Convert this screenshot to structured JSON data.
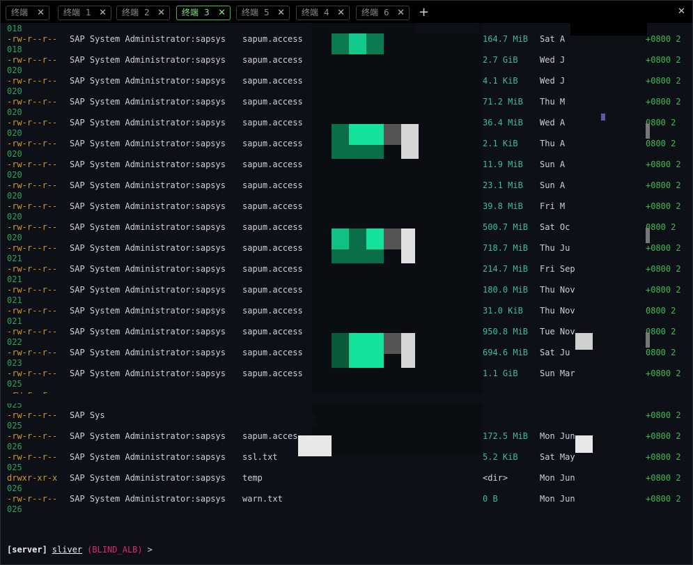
{
  "tabs": [
    {
      "label": "终端",
      "num": ""
    },
    {
      "label": "终端",
      "num": "1"
    },
    {
      "label": "终端",
      "num": "2"
    },
    {
      "label": "终端",
      "num": "3",
      "active": true
    },
    {
      "label": "终端",
      "num": "5"
    },
    {
      "label": "终端",
      "num": "4"
    },
    {
      "label": "终端",
      "num": "6"
    }
  ],
  "new_tab": "+",
  "close_glyph": "✕",
  "continuations": [
    "018",
    "018",
    "020",
    "020",
    "020",
    "020",
    "020",
    "020",
    "020",
    "020",
    "020",
    "021",
    "021",
    "021",
    "021",
    "022",
    "023",
    "025",
    "025",
    "025",
    "026",
    "025",
    "026",
    "026"
  ],
  "listing": [
    {
      "perm": "-rw-r--r--",
      "owner": "SAP System Administrator:sapsys",
      "name": "sapum.access",
      "size": "164.7 MiB",
      "date": "Sat A",
      "tz": "+0800 2"
    },
    {
      "perm": "-rw-r--r--",
      "owner": "SAP System Administrator:sapsys",
      "name": "sapum.access",
      "size": "2.7 GiB",
      "date": "Wed J",
      "tz": "+0800 2"
    },
    {
      "perm": "-rw-r--r--",
      "owner": "SAP System Administrator:sapsys",
      "name": "sapum.access",
      "size": "4.1 KiB",
      "date": "Wed J",
      "tz": "+0800 2"
    },
    {
      "perm": "-rw-r--r--",
      "owner": "SAP System Administrator:sapsys",
      "name": "sapum.access",
      "size": "71.2 MiB",
      "date": "Thu M",
      "tz": "+0800 2"
    },
    {
      "perm": "-rw-r--r--",
      "owner": "SAP System Administrator:sapsys",
      "name": "sapum.access",
      "size": "36.4 MiB",
      "date": "Wed A",
      "tz": "0800 2"
    },
    {
      "perm": "-rw-r--r--",
      "owner": "SAP System Administrator:sapsys",
      "name": "sapum.access",
      "size": "2.1 KiB",
      "date": "Thu A",
      "tz": "0800 2"
    },
    {
      "perm": "-rw-r--r--",
      "owner": "SAP System Administrator:sapsys",
      "name": "sapum.access",
      "size": "11.9 MiB",
      "date": "Sun A",
      "tz": "+0800 2"
    },
    {
      "perm": "-rw-r--r--",
      "owner": "SAP System Administrator:sapsys",
      "name": "sapum.access",
      "size": "23.1 MiB",
      "date": "Sun A",
      "tz": "+0800 2"
    },
    {
      "perm": "-rw-r--r--",
      "owner": "SAP System Administrator:sapsys",
      "name": "sapum.access",
      "size": "39.8 MiB",
      "date": "Fri M",
      "tz": "+0800 2"
    },
    {
      "perm": "-rw-r--r--",
      "owner": "SAP System Administrator:sapsys",
      "name": "sapum.access",
      "size": "500.7 MiB",
      "date": "Sat Oc",
      "tz": "0800 2"
    },
    {
      "perm": "-rw-r--r--",
      "owner": "SAP System Administrator:sapsys",
      "name": "sapum.access",
      "size": "718.7 MiB",
      "date": "Thu Ju",
      "tz": "+0800 2"
    },
    {
      "perm": "-rw-r--r--",
      "owner": "SAP System Administrator:sapsys",
      "name": "sapum.access",
      "size": "214.7 MiB",
      "date": "Fri Sep",
      "tz": "+0800 2"
    },
    {
      "perm": "-rw-r--r--",
      "owner": "SAP System Administrator:sapsys",
      "name": "sapum.access",
      "size": "180.0 MiB",
      "date": "Thu Nov",
      "tz": "+0800 2"
    },
    {
      "perm": "-rw-r--r--",
      "owner": "SAP System Administrator:sapsys",
      "name": "sapum.access",
      "size": "31.0 KiB",
      "date": "Thu Nov",
      "tz": "0800 2"
    },
    {
      "perm": "-rw-r--r--",
      "owner": "SAP System Administrator:sapsys",
      "name": "sapum.access",
      "size": "950.8 MiB",
      "date": "Tue Nov",
      "tz": "0800 2"
    },
    {
      "perm": "-rw-r--r--",
      "owner": "SAP System Administrator:sapsys",
      "name": "sapum.access",
      "size": "694.6 MiB",
      "date": "Sat Ju",
      "tz": "0800 2"
    },
    {
      "perm": "-rw-r--r--",
      "owner": "SAP System Administrator:sapsys",
      "name": "sapum.access",
      "size": "1.1 GiB",
      "date": "Sun Mar",
      "tz": "+0800 2"
    },
    {
      "perm": "-rw-r--r--",
      "owner": "",
      "name": "",
      "size": "",
      "date": "",
      "tz": ""
    },
    {
      "perm": "-rw-r--r--",
      "owner": "SAP Sys",
      "name": "",
      "size": "",
      "date": "",
      "tz": "+0800 2"
    },
    {
      "perm": "-rw-r--r--",
      "owner": "SAP System Administrator:sapsys",
      "name": "sapum.acces",
      "size": "172.5 MiB",
      "date": "Mon Jun",
      "tz": "+0800 2"
    },
    {
      "perm": "-rw-r--r--",
      "owner": "SAP System Administrator:sapsys",
      "name": "ssl.txt",
      "size": "5.2 KiB",
      "date": "Sat May",
      "tz": "+0800 2"
    },
    {
      "perm": "drwxr-xr-x",
      "owner": "SAP System Administrator:sapsys",
      "name": "temp",
      "size": "<dir>",
      "date": "Mon Jun",
      "tz": "+0800 2",
      "dir": true
    },
    {
      "perm": "-rw-r--r--",
      "owner": "SAP System Administrator:sapsys",
      "name": "warn.txt",
      "size": "0 B",
      "date": "Mon Jun",
      "tz": "+0800 2"
    }
  ],
  "prompt": {
    "server": "[server]",
    "app": "sliver",
    "session": "(BLIND_ALB)",
    "caret": ">"
  }
}
